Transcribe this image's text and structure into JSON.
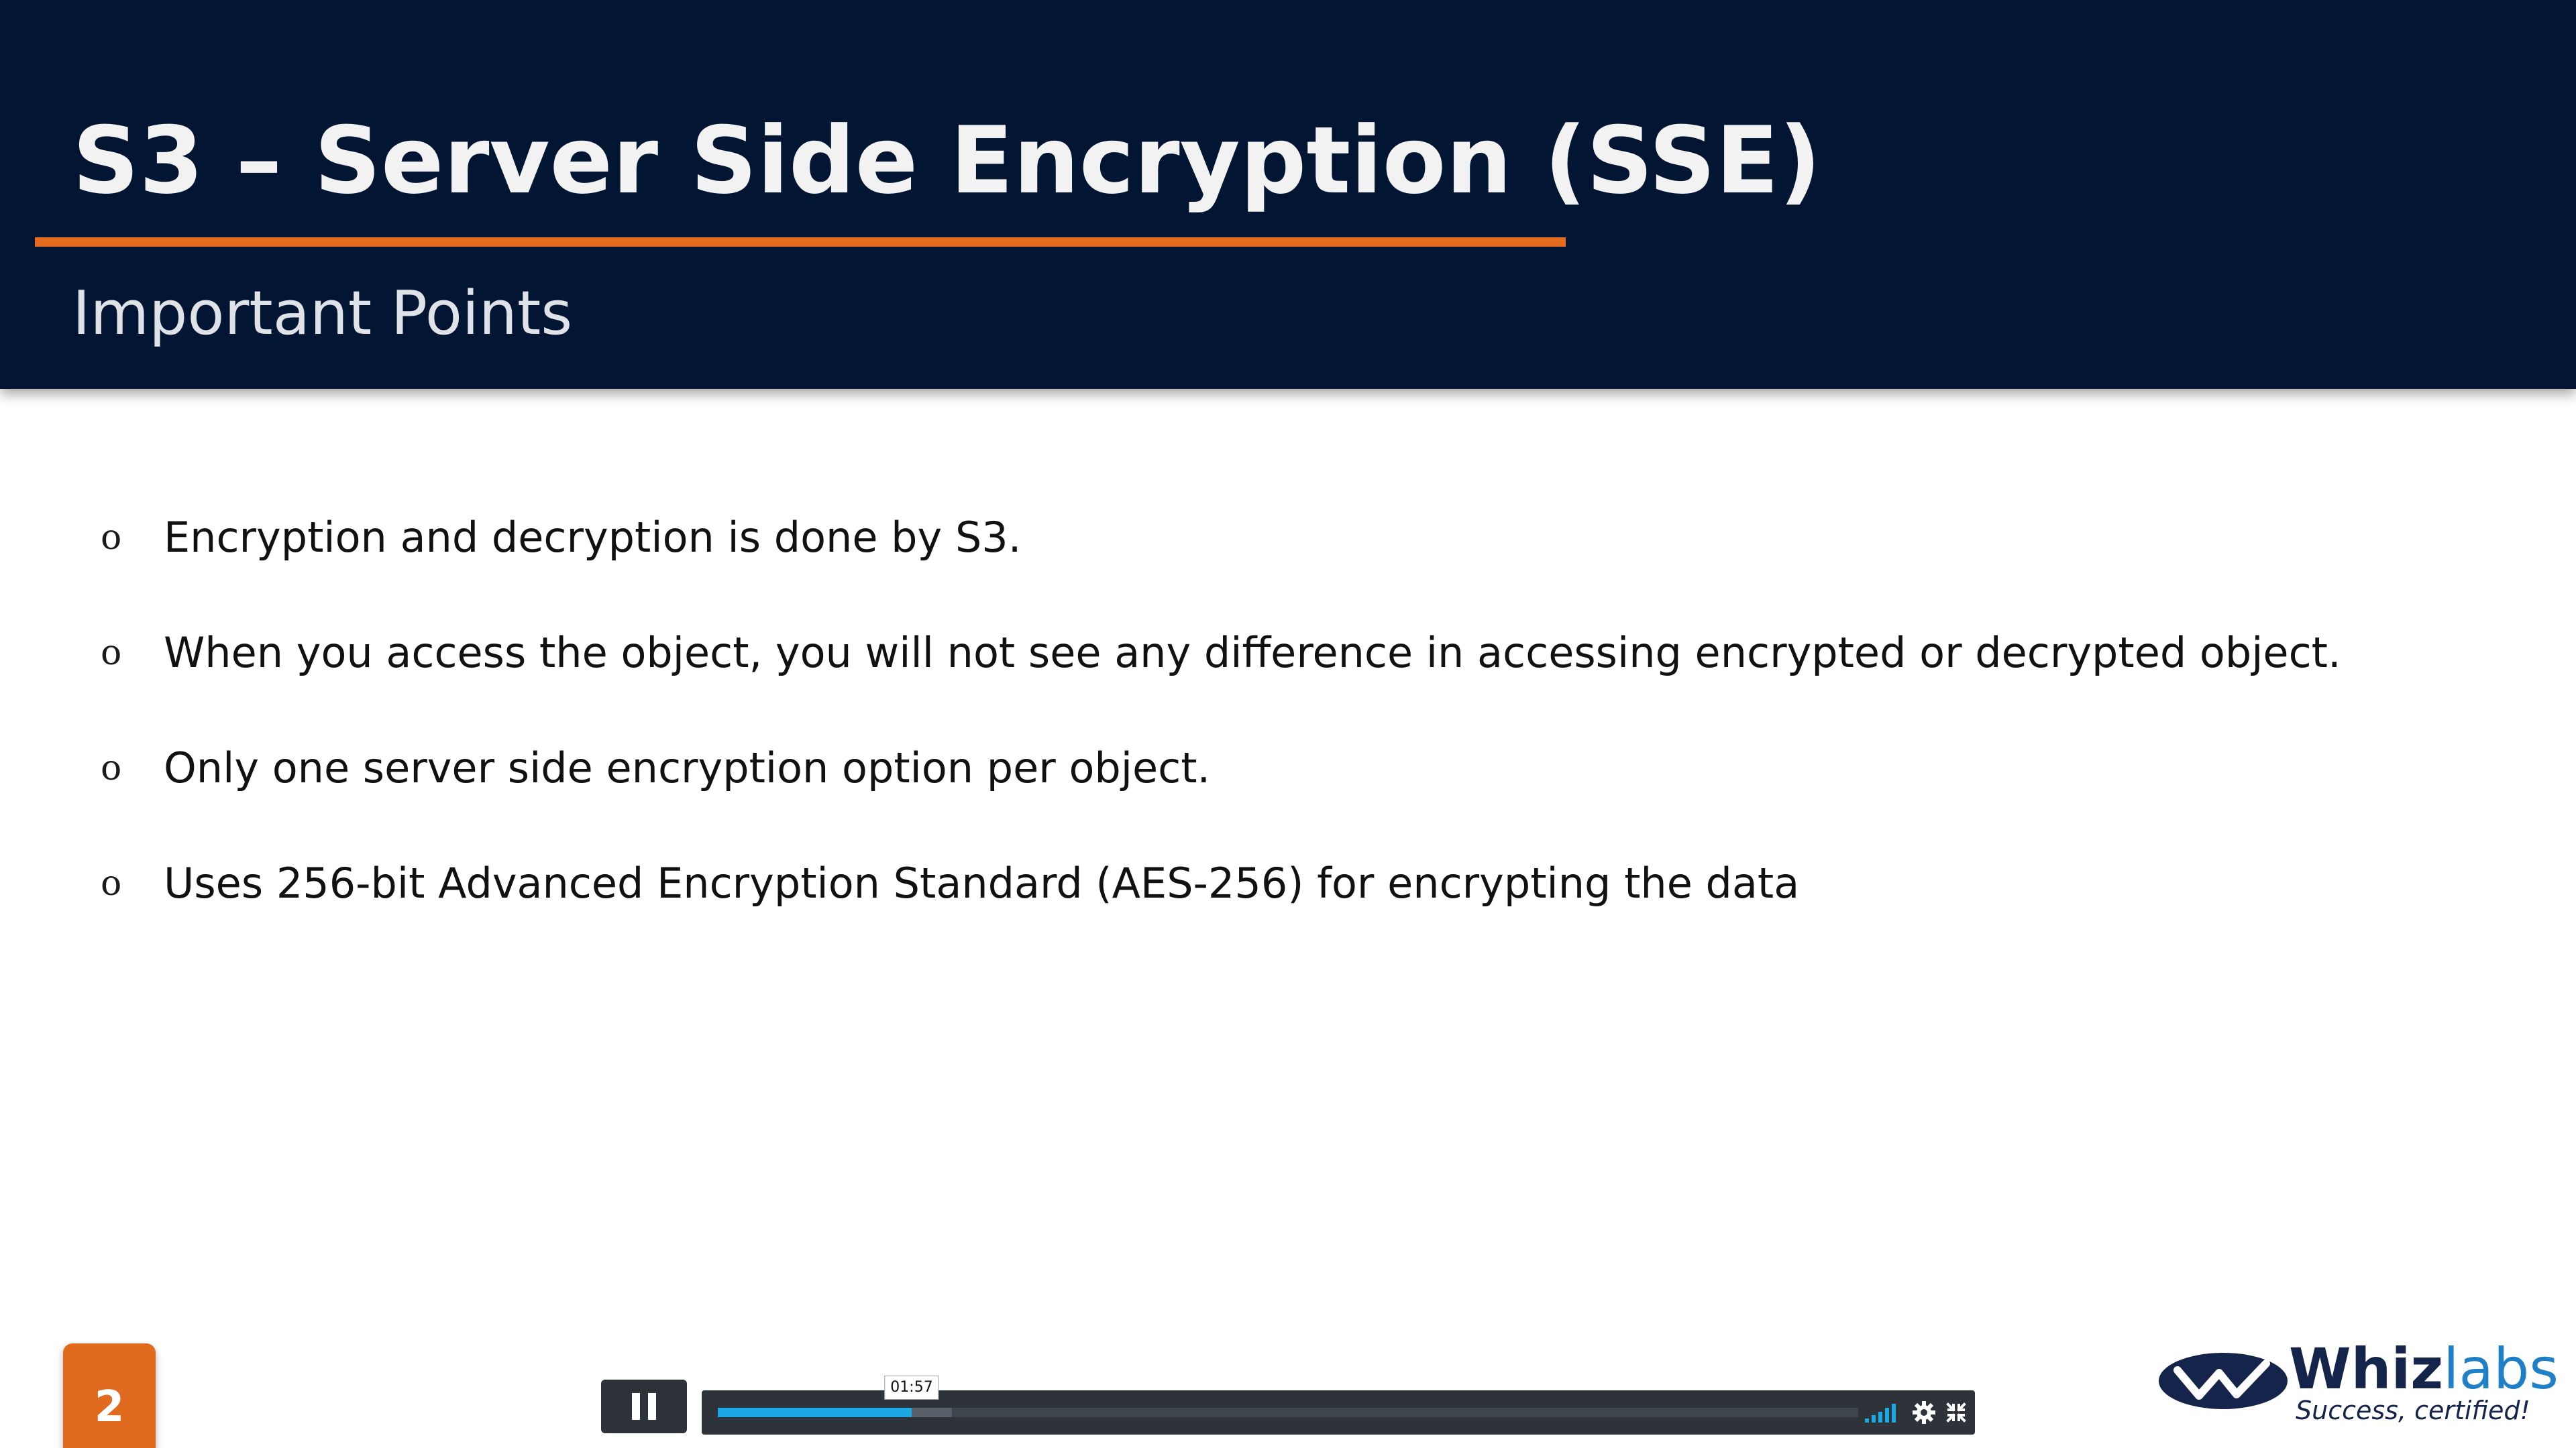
{
  "slide": {
    "title": "S3 – Server Side Encryption (SSE)",
    "subtitle": "Important Points",
    "bullet_marker": "o",
    "bullets": [
      "Encryption and decryption is done by S3.",
      "When you access the object, you will not see any difference in accessing encrypted or decrypted object.",
      "Only one server side encryption option per object.",
      "Uses 256-bit Advanced Encryption Standard (AES-256) for encrypting the data"
    ],
    "page_number": "2"
  },
  "player": {
    "state": "playing",
    "play_button_icon": "pause-icon",
    "current_time": "01:57",
    "progress_fraction": 0.17,
    "buffered_fraction": 0.205,
    "icons": [
      "volume-icon",
      "settings-icon",
      "fullscreen-icon"
    ]
  },
  "logo": {
    "word_strong": "Whiz",
    "word_light": "labs",
    "tagline": "Success, certified!"
  },
  "colors": {
    "header_bg": "#021633",
    "accent_orange": "#e56b1f",
    "progress_blue": "#1ca8e3",
    "player_bg": "#2d3338"
  }
}
